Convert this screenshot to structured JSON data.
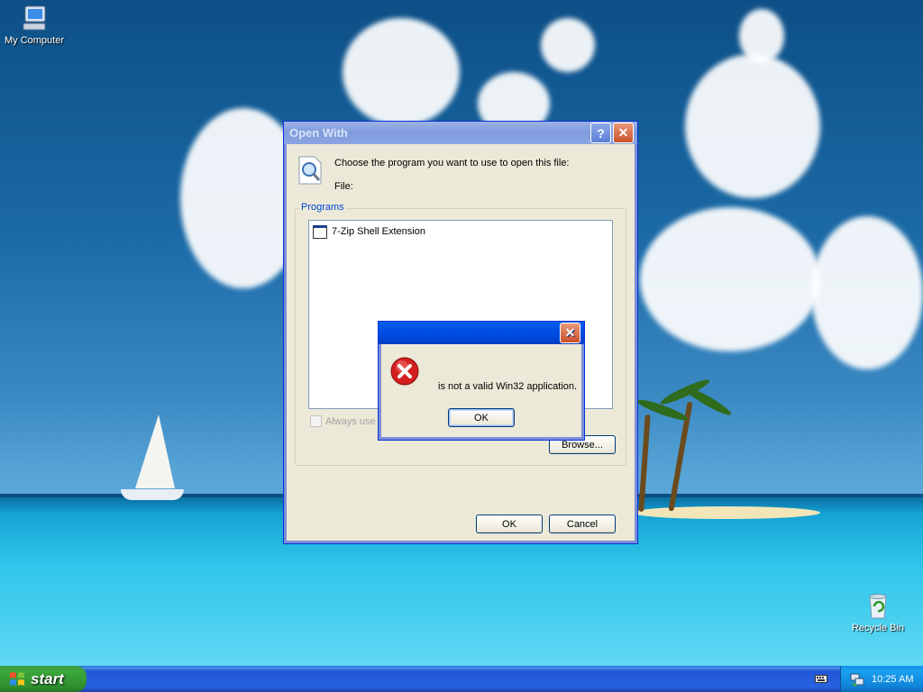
{
  "desktop": {
    "icons": {
      "my_computer": "My Computer",
      "recycle_bin": "Recycle Bin"
    }
  },
  "open_with_dialog": {
    "title": "Open With",
    "help_icon": "help-icon",
    "close_icon": "close-icon",
    "instruction": "Choose the program you want to use to open this file:",
    "file_label": "File:",
    "programs_group_label": "Programs",
    "programs": [
      {
        "name": "7-Zip Shell Extension",
        "icon": "program-window-icon",
        "selected": false
      }
    ],
    "always_use_label": "Always use t",
    "always_use_checked": false,
    "browse_button": "Browse...",
    "ok_button": "OK",
    "cancel_button": "Cancel"
  },
  "error_dialog": {
    "title": "",
    "icon": "error-icon",
    "message": "is not a valid Win32 application.",
    "ok_button": "OK"
  },
  "taskbar": {
    "start_label": "start",
    "clock": "10:25 AM"
  },
  "colors": {
    "taskbar_blue": "#2663e0",
    "start_green": "#3aa83a",
    "dialog_face": "#ece9d8",
    "error_red": "#d21f1f"
  }
}
